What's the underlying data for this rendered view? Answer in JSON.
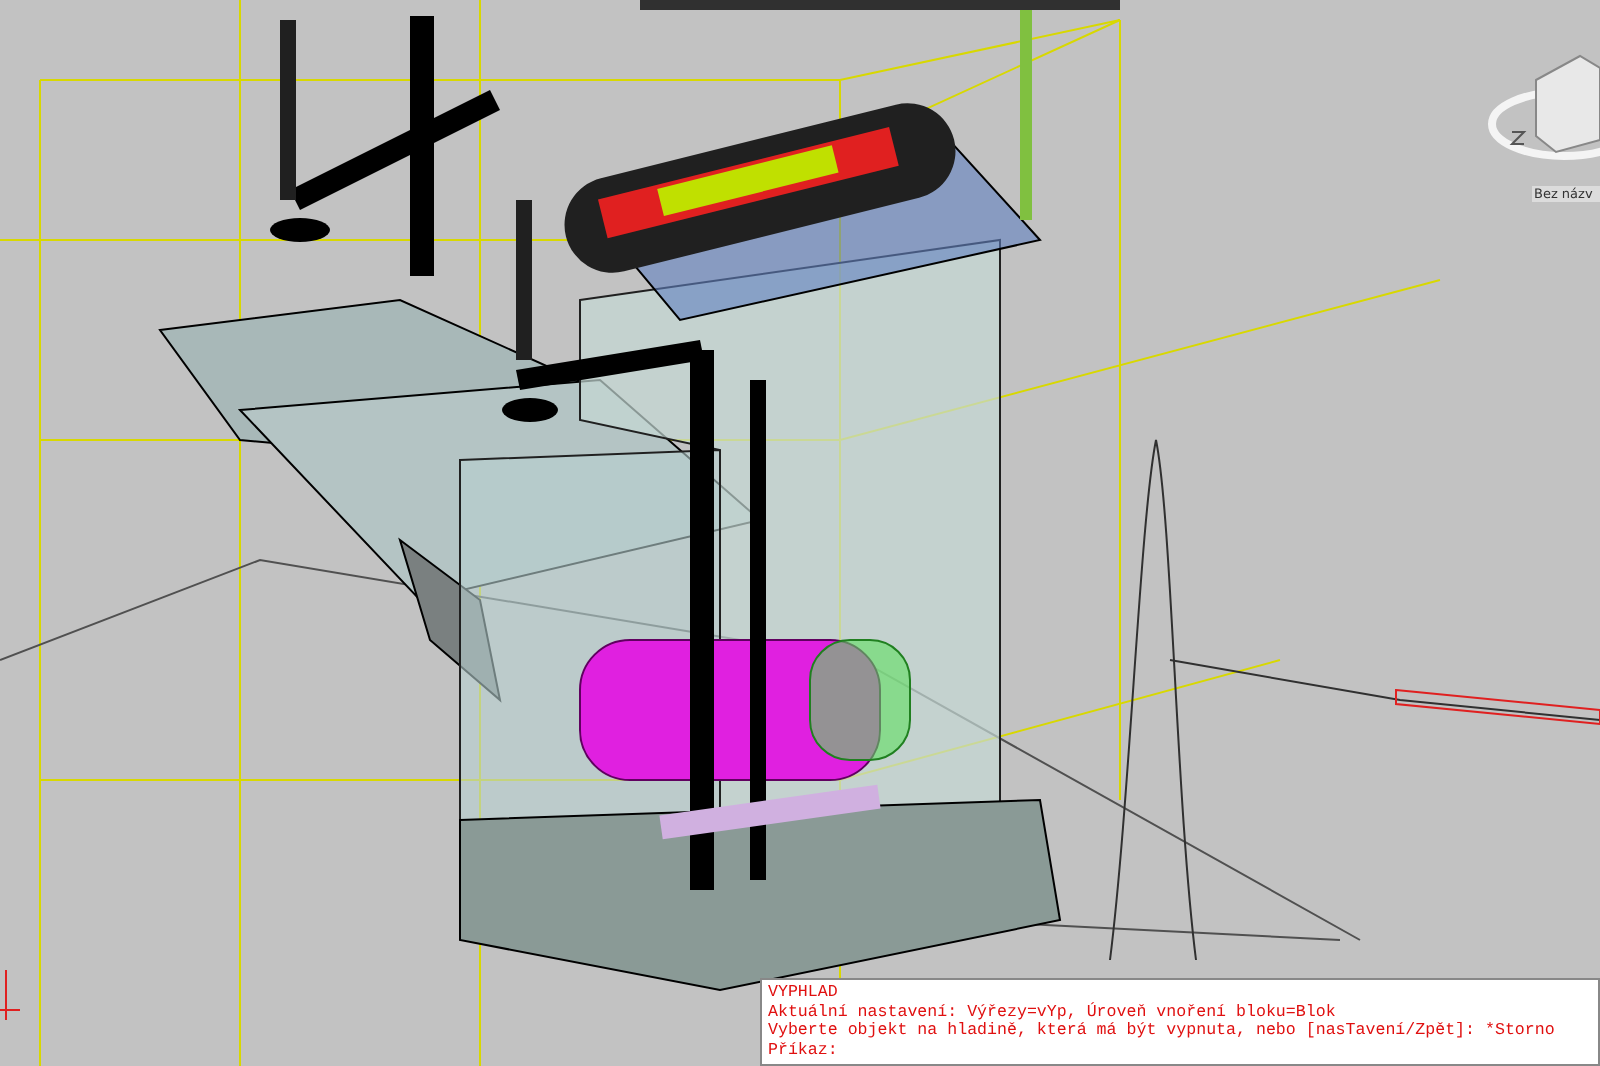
{
  "viewport": {
    "view_label": "Bez názv"
  },
  "command_line": {
    "lines": [
      "VYPHLAD",
      "Aktuální nastavení: Výřezy=vYp, Úroveň vnoření bloku=Blok",
      "Vyberte objekt na hladině, která má být vypnuta, nebo [nasTavení/Zpět]: *Storno",
      "Příkaz:"
    ]
  }
}
